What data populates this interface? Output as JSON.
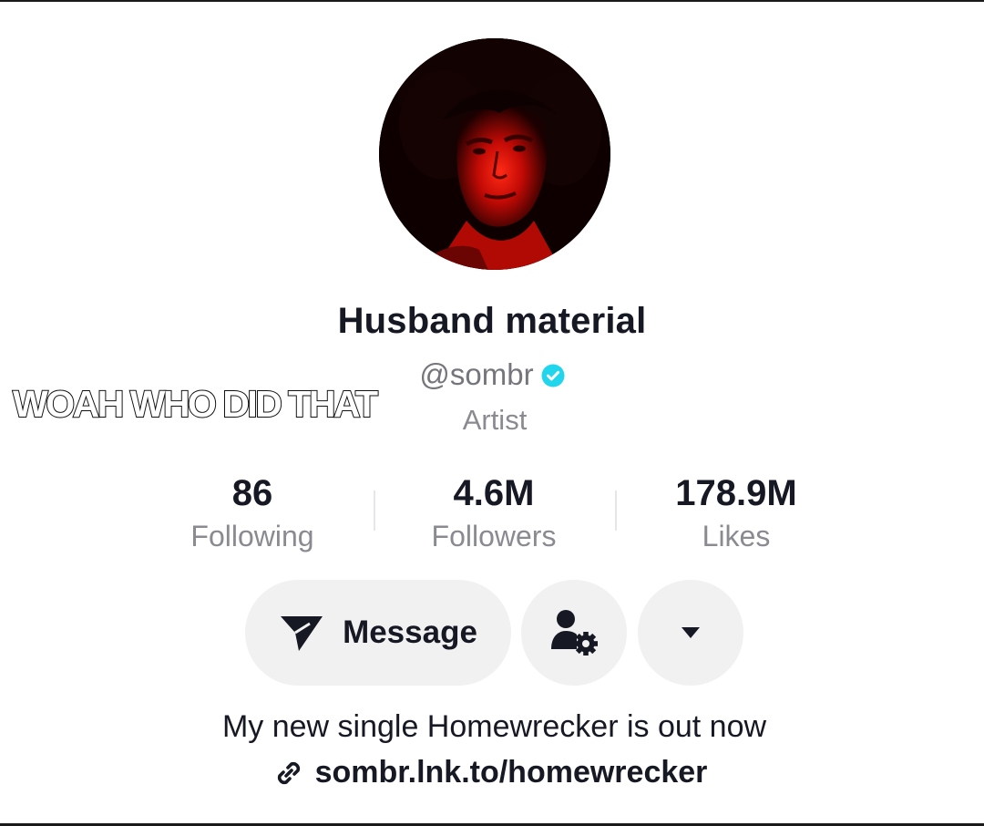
{
  "profile": {
    "display_name": "Husband material",
    "handle": "@sombr",
    "verified": true,
    "category": "Artist"
  },
  "overlay": {
    "caption": "WOAH WHO DID THAT"
  },
  "stats": {
    "following": {
      "value": "86",
      "label": "Following"
    },
    "followers": {
      "value": "4.6M",
      "label": "Followers"
    },
    "likes": {
      "value": "178.9M",
      "label": "Likes"
    }
  },
  "actions": {
    "message_label": "Message",
    "message_icon": "send-icon",
    "profile_settings_icon": "user-gear-icon",
    "more_icon": "caret-down-icon"
  },
  "bio": {
    "text": "My new single Homewrecker is out now",
    "link_icon": "link-icon",
    "link": "sombr.lnk.to/homewrecker"
  },
  "colors": {
    "verified_badge": "#20d5ec",
    "button_bg": "#f1f1f2",
    "text_primary": "#161823",
    "text_secondary": "#8a8b90",
    "avatar_tint": "#e3120b"
  }
}
